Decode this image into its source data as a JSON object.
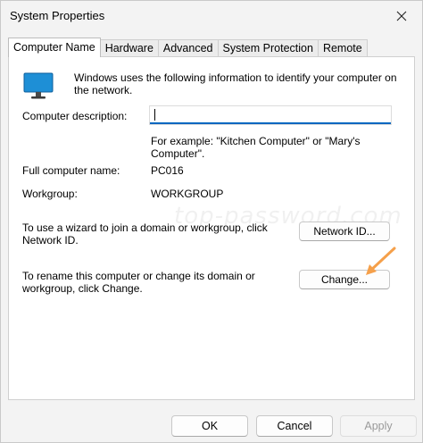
{
  "window": {
    "title": "System Properties"
  },
  "tabs": [
    {
      "label": "Computer Name",
      "active": true
    },
    {
      "label": "Hardware",
      "active": false
    },
    {
      "label": "Advanced",
      "active": false
    },
    {
      "label": "System Protection",
      "active": false
    },
    {
      "label": "Remote",
      "active": false
    }
  ],
  "panel": {
    "intro": "Windows uses the following information to identify your computer on the network.",
    "description_label": "Computer description:",
    "description_value": "",
    "example": "For example: \"Kitchen Computer\" or \"Mary's Computer\".",
    "full_name_label": "Full computer name:",
    "full_name_value": "PC016",
    "workgroup_label": "Workgroup:",
    "workgroup_value": "WORKGROUP",
    "network_text": "To use a wizard to join a domain or workgroup, click Network ID.",
    "network_button": "Network ID...",
    "rename_text": "To rename this computer or change its domain or workgroup, click Change.",
    "change_button": "Change..."
  },
  "watermark": "top-password.com",
  "footer": {
    "ok": "OK",
    "cancel": "Cancel",
    "apply": "Apply"
  },
  "colors": {
    "accent": "#0067c0",
    "arrow": "#f5a04a",
    "monitor": "#1e8fd6"
  }
}
